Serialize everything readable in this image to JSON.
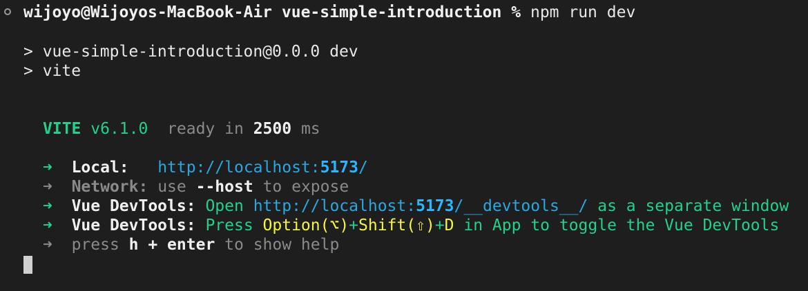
{
  "prompt": {
    "user_host": "wijoyo@Wijoyos-MacBook-Air",
    "directory": "vue-simple-introduction",
    "symbol": "%",
    "command": "npm run dev"
  },
  "script_lines": [
    "> vue-simple-introduction@0.0.0 dev",
    "> vite"
  ],
  "vite": {
    "name": "VITE",
    "version": "v6.1.0",
    "ready_text": "ready in",
    "ready_ms": "2500",
    "ms_unit": "ms"
  },
  "arrow": "➜",
  "local": {
    "label": "Local:",
    "url_prefix": "http://localhost:",
    "port": "5173",
    "url_suffix": "/"
  },
  "network": {
    "label": "Network:",
    "text1": "use",
    "flag": "--host",
    "text2": "to expose"
  },
  "devtools1": {
    "label": "Vue DevTools:",
    "open": "Open",
    "url_prefix": "http://localhost:",
    "port": "5173",
    "url_suffix": "/__devtools__/",
    "rest": "as a separate window"
  },
  "devtools2": {
    "label": "Vue DevTools:",
    "press": "Press",
    "key1": "Option(⌥)",
    "plus1": "+",
    "key2": "Shift(⇧)",
    "plus2": "+",
    "key3": "D",
    "rest": "in App to toggle the Vue DevTools"
  },
  "help": {
    "press": "press",
    "keys": "h + enter",
    "rest": "to show help"
  },
  "colors": {
    "background": "#1e1e1e",
    "green": "#23d18b",
    "cyan": "#29a8e0",
    "yellow": "#f5f543",
    "gray": "#8a8a8a"
  }
}
